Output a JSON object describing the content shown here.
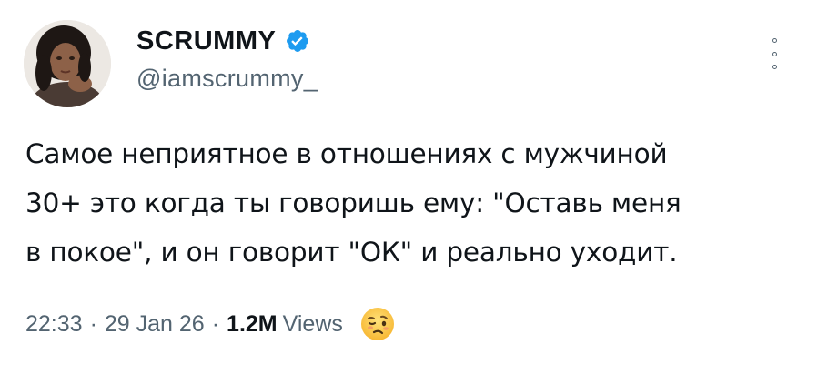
{
  "tweet": {
    "author": {
      "display_name": "SCRUMMY",
      "handle": "@iamscrummy_",
      "verified": true,
      "avatar_icon": "profile-photo"
    },
    "text_lines": [
      "Самое неприятное в отношениях с мужчиной",
      "30+ это когда ты говоришь ему: \"Оставь меня",
      "в покое\", и он говорит \"ОК\" и реально уходит."
    ],
    "time": "22:33",
    "separator": "·",
    "date": "29 Jan 26",
    "views_count": "1.2M",
    "views_label": "Views",
    "reaction_emoji": "confused-face-emoji"
  },
  "colors": {
    "text_primary": "#0f1419",
    "text_secondary": "#536471",
    "verified_blue": "#1d9bf0",
    "background": "#ffffff"
  },
  "icons": {
    "more": "more-options-icon",
    "verified": "verified-badge-icon"
  }
}
